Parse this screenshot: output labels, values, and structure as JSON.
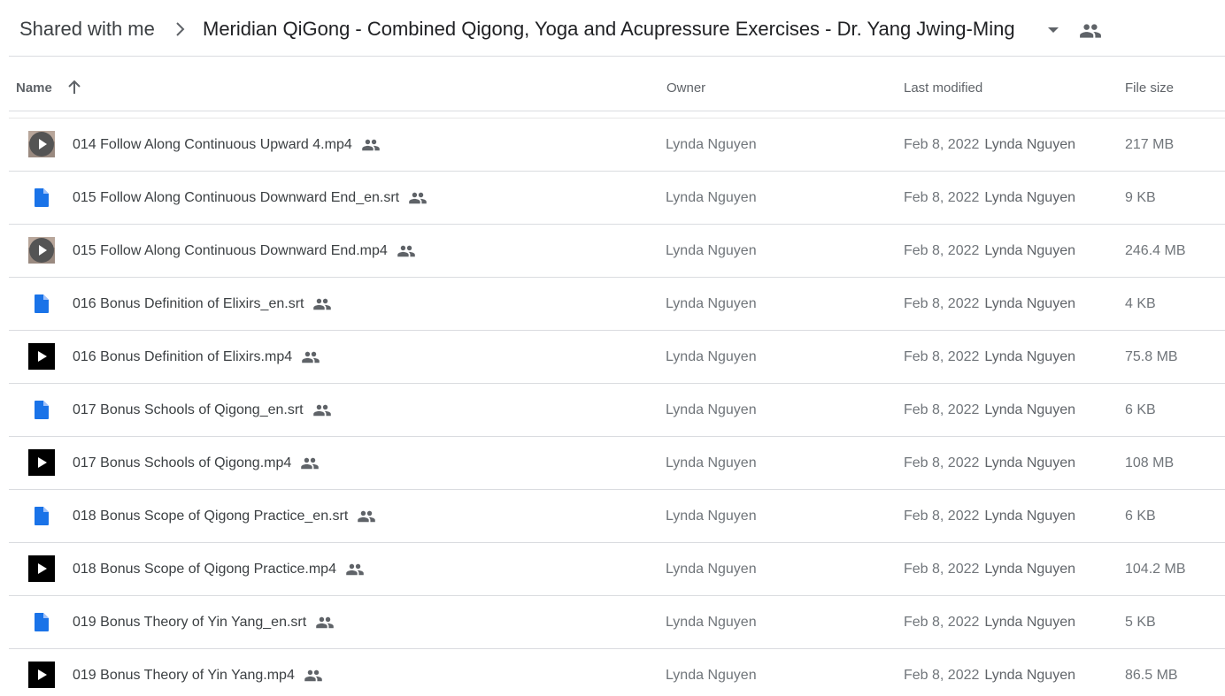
{
  "breadcrumb": {
    "root": "Shared with me",
    "current": "Meridian QiGong - Combined Qigong, Yoga and Acupressure Exercises - Dr. Yang Jwing-Ming"
  },
  "columns": {
    "name": "Name",
    "owner": "Owner",
    "last_modified": "Last modified",
    "file_size": "File size",
    "sort": "ascending"
  },
  "colors": {
    "text": "#3c4043",
    "muted": "#70757a",
    "divider": "#dadce0",
    "doc_blue": "#1a73e8"
  },
  "files": [
    {
      "name": "014 Follow Along Continuous Upward 4.mp4",
      "icon": "video-thumbnail-icon",
      "owner": "Lynda Nguyen",
      "modified_date": "Feb 8, 2022",
      "modified_by": "Lynda Nguyen",
      "size": "217 MB"
    },
    {
      "name": "015 Follow Along Continuous Downward End_en.srt",
      "icon": "document-icon",
      "owner": "Lynda Nguyen",
      "modified_date": "Feb 8, 2022",
      "modified_by": "Lynda Nguyen",
      "size": "9 KB"
    },
    {
      "name": "015 Follow Along Continuous Downward End.mp4",
      "icon": "video-thumbnail-icon",
      "owner": "Lynda Nguyen",
      "modified_date": "Feb 8, 2022",
      "modified_by": "Lynda Nguyen",
      "size": "246.4 MB"
    },
    {
      "name": "016 Bonus Definition of Elixirs_en.srt",
      "icon": "document-icon",
      "owner": "Lynda Nguyen",
      "modified_date": "Feb 8, 2022",
      "modified_by": "Lynda Nguyen",
      "size": "4 KB"
    },
    {
      "name": "016 Bonus Definition of Elixirs.mp4",
      "icon": "video-icon",
      "owner": "Lynda Nguyen",
      "modified_date": "Feb 8, 2022",
      "modified_by": "Lynda Nguyen",
      "size": "75.8 MB"
    },
    {
      "name": "017 Bonus Schools of Qigong_en.srt",
      "icon": "document-icon",
      "owner": "Lynda Nguyen",
      "modified_date": "Feb 8, 2022",
      "modified_by": "Lynda Nguyen",
      "size": "6 KB"
    },
    {
      "name": "017 Bonus Schools of Qigong.mp4",
      "icon": "video-icon",
      "owner": "Lynda Nguyen",
      "modified_date": "Feb 8, 2022",
      "modified_by": "Lynda Nguyen",
      "size": "108 MB"
    },
    {
      "name": "018 Bonus Scope of Qigong Practice_en.srt",
      "icon": "document-icon",
      "owner": "Lynda Nguyen",
      "modified_date": "Feb 8, 2022",
      "modified_by": "Lynda Nguyen",
      "size": "6 KB"
    },
    {
      "name": "018 Bonus Scope of Qigong Practice.mp4",
      "icon": "video-icon",
      "owner": "Lynda Nguyen",
      "modified_date": "Feb 8, 2022",
      "modified_by": "Lynda Nguyen",
      "size": "104.2 MB"
    },
    {
      "name": "019 Bonus Theory of Yin Yang_en.srt",
      "icon": "document-icon",
      "owner": "Lynda Nguyen",
      "modified_date": "Feb 8, 2022",
      "modified_by": "Lynda Nguyen",
      "size": "5 KB"
    },
    {
      "name": "019 Bonus Theory of Yin Yang.mp4",
      "icon": "video-icon",
      "owner": "Lynda Nguyen",
      "modified_date": "Feb 8, 2022",
      "modified_by": "Lynda Nguyen",
      "size": "86.5 MB"
    }
  ]
}
